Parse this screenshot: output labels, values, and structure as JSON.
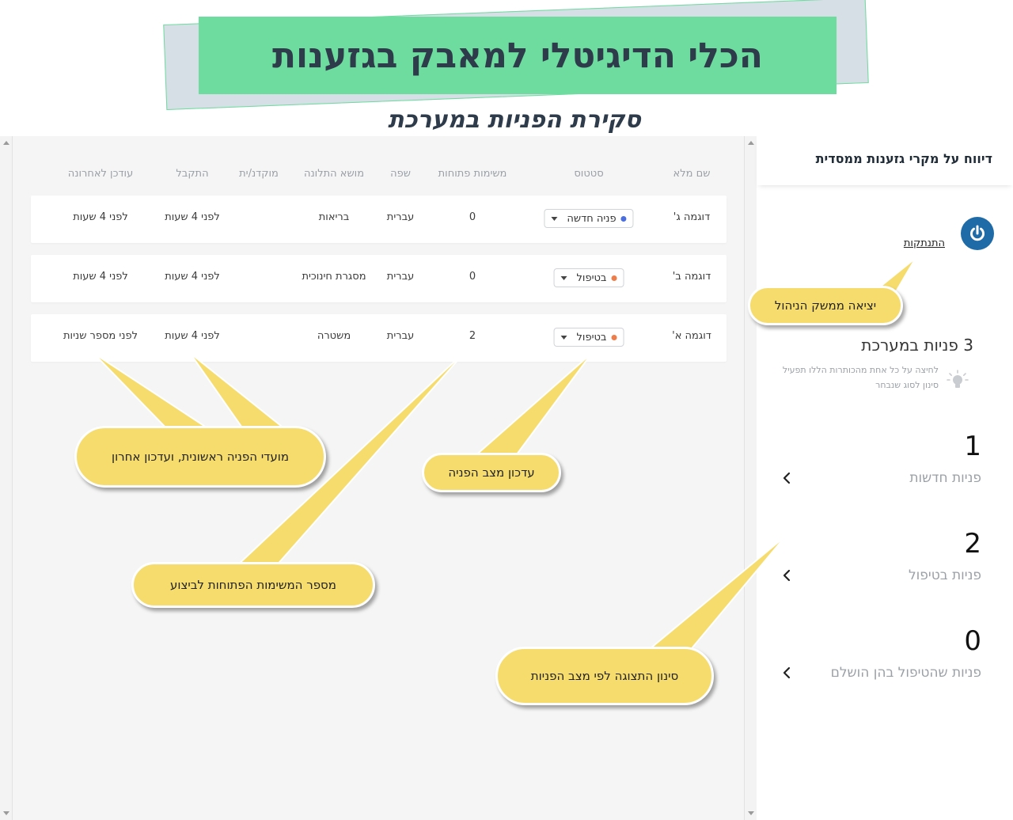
{
  "header": {
    "banner_title": "הכלי הדיגיטלי למאבק בגזענות",
    "subtitle": "סקירת הפניות במערכת"
  },
  "colors": {
    "banner_green": "#6ddc9e",
    "banner_back": "#d6dfe6",
    "title_text": "#2e3b4a",
    "callout_yellow": "#f5dc6c",
    "status_new": "#4a6ee0",
    "status_in_treatment": "#ef7d4a",
    "logout_icon": "#1e6ba8"
  },
  "table": {
    "columns": [
      "שם מלא",
      "סטטוס",
      "משימות פתוחות",
      "שפה",
      "מושא התלונה",
      "מוקדנ/ית",
      "התקבל",
      "עודכן לאחרונה"
    ],
    "rows": [
      {
        "name": "דוגמה ג'",
        "status": "פניה חדשה",
        "status_color": "#4a6ee0",
        "tasks": "0",
        "language": "עברית",
        "subject": "בריאות",
        "agent": "",
        "received": "לפני 4 שעות",
        "updated": "לפני 4 שעות"
      },
      {
        "name": "דוגמה ב'",
        "status": "בטיפול",
        "status_color": "#ef7d4a",
        "tasks": "0",
        "language": "עברית",
        "subject": "מסגרת חינוכית",
        "agent": "",
        "received": "לפני 4 שעות",
        "updated": "לפני 4 שעות"
      },
      {
        "name": "דוגמה א'",
        "status": "בטיפול",
        "status_color": "#ef7d4a",
        "tasks": "2",
        "language": "עברית",
        "subject": "משטרה",
        "agent": "",
        "received": "לפני 4 שעות",
        "updated": "לפני מספר שניות"
      }
    ]
  },
  "sidebar": {
    "title": "דיווח על מקרי גזענות ממסדית",
    "logout_label": "התנתקות",
    "logout_icon": "power-icon",
    "count_title": "3 פניות במערכת",
    "hint": "לחיצה על כל אחת מהכותרות הללו תפעיל סינון לסוג שנבחר",
    "hint_icon": "lightbulb-icon",
    "filters": [
      {
        "count": "1",
        "label": "פניות חדשות"
      },
      {
        "count": "2",
        "label": "פניות בטיפול"
      },
      {
        "count": "0",
        "label": "פניות שהטיפול בהן הושלם"
      }
    ]
  },
  "callouts": {
    "logout": "יציאה ממשק הניהול",
    "dates": "מועדי הפניה ראשונית, ועדכון אחרון",
    "status": "עדכון מצב הפניה",
    "tasks": "מספר המשימות הפתוחות לביצוע",
    "filter": "סינון התצוגה לפי מצב הפניות"
  }
}
